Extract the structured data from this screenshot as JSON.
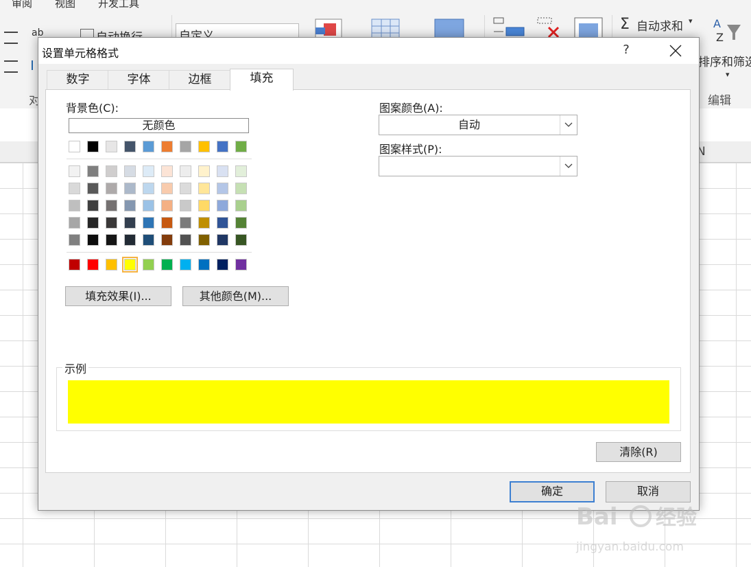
{
  "excel": {
    "ribbon_tabs": [
      "审阅",
      "视图",
      "开发工具"
    ],
    "wrap_text": "自动换行",
    "number_format": "自定义",
    "autosum": "自动求和",
    "sort_filter": "排序和筛选",
    "group_align": "对",
    "group_edit": "编辑",
    "col_n": "N"
  },
  "dialog": {
    "title": "设置单元格格式",
    "help": "?",
    "tabs": [
      "数字",
      "字体",
      "边框",
      "填充"
    ],
    "active_tab": "填充",
    "bg_color_label": "背景色(C):",
    "no_color": "无颜色",
    "pattern_color_label": "图案颜色(A):",
    "pattern_color_value": "自动",
    "pattern_style_label": "图案样式(P):",
    "pattern_style_value": "",
    "fill_effects": "填充效果(I)...",
    "more_colors": "其他颜色(M)...",
    "sample_label": "示例",
    "sample_color": "#FFFF00",
    "clear": "清除(R)",
    "ok": "确定",
    "cancel": "取消"
  },
  "palette": {
    "theme_row": [
      "#FFFFFF",
      "#000000",
      "#E7E6E6",
      "#44546A",
      "#5B9BD5",
      "#ED7D31",
      "#A5A5A5",
      "#FFC000",
      "#4472C4",
      "#70AD47"
    ],
    "tint_rows": [
      [
        "#F2F2F2",
        "#7F7F7F",
        "#D0CECE",
        "#D6DCE4",
        "#DDEBF7",
        "#FCE4D6",
        "#EDEDED",
        "#FFF2CC",
        "#D9E1F2",
        "#E2EFDA"
      ],
      [
        "#D9D9D9",
        "#595959",
        "#AEAAAA",
        "#ACB9CA",
        "#BDD7EE",
        "#F8CBAD",
        "#DBDBDB",
        "#FFE699",
        "#B4C6E7",
        "#C6E0B4"
      ],
      [
        "#BFBFBF",
        "#404040",
        "#757171",
        "#8497B0",
        "#9BC2E6",
        "#F4B084",
        "#C9C9C9",
        "#FFD966",
        "#8EA9DB",
        "#A9D08E"
      ],
      [
        "#A6A6A6",
        "#262626",
        "#3A3838",
        "#333F4F",
        "#2F75B5",
        "#C65911",
        "#7B7B7B",
        "#BF8F00",
        "#305496",
        "#548235"
      ],
      [
        "#808080",
        "#0D0D0D",
        "#161616",
        "#222B35",
        "#1F4E78",
        "#833C0C",
        "#525252",
        "#806000",
        "#203764",
        "#375623"
      ]
    ],
    "standard_row": [
      "#C00000",
      "#FF0000",
      "#FFC000",
      "#FFFF00",
      "#92D050",
      "#00B050",
      "#00B0F0",
      "#0070C0",
      "#002060",
      "#7030A0"
    ],
    "selected": "#FFFF00"
  },
  "watermark": {
    "brand": "Bai",
    "brand_cn": "经验",
    "url": "jingyan.baidu.com"
  }
}
